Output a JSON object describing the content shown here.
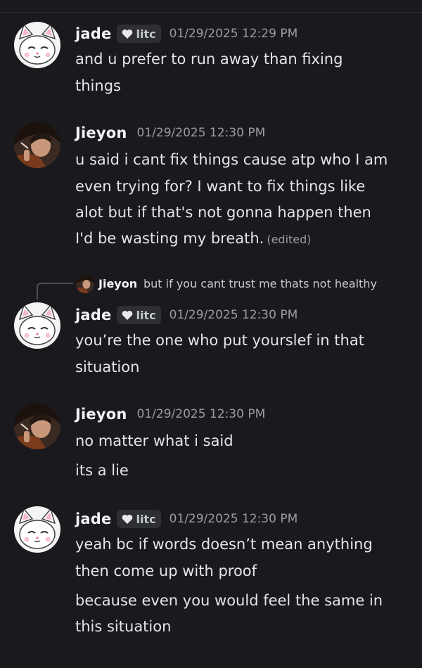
{
  "messages": [
    {
      "author": "jade",
      "tag": "litc",
      "timestamp": "01/29/2025 12:29 PM",
      "lines": [
        "and u prefer to run away than fixing",
        "things"
      ]
    },
    {
      "author": "Jieyon",
      "timestamp": "01/29/2025 12:30 PM",
      "lines": [
        "u said i cant fix things cause atp who I am",
        "even trying for? I want to fix things like",
        "alot but if that's not gonna happen then",
        "I'd be wasting my breath."
      ],
      "edited_label": "(edited)"
    },
    {
      "reply": {
        "author": "Jieyon",
        "text": "but if you cant trust me thats not healthy"
      },
      "author": "jade",
      "tag": "litc",
      "timestamp": "01/29/2025 12:30 PM",
      "lines": [
        "you’re the one who put yourslef in that",
        "situation"
      ]
    },
    {
      "author": "Jieyon",
      "timestamp": "01/29/2025 12:30 PM",
      "lines": [
        "no matter what i said",
        "its a lie"
      ]
    },
    {
      "author": "jade",
      "tag": "litc",
      "timestamp": "01/29/2025 12:30 PM",
      "lines": [
        "yeah bc if words doesn’t mean anything",
        "then come up with proof",
        "because even you would feel the same in",
        "this situation"
      ]
    }
  ],
  "icons": {
    "cat_avatar": "cat-avatar-icon",
    "jieyon_avatar": "jieyon-avatar-icon",
    "tag_heart": "heart-icon"
  },
  "colors": {
    "background": "#1a1a1e",
    "name": "#f2f3f5",
    "timestamp": "#9a9ca3",
    "text": "#e3e5e8",
    "tag_bg": "#2e2f35"
  }
}
